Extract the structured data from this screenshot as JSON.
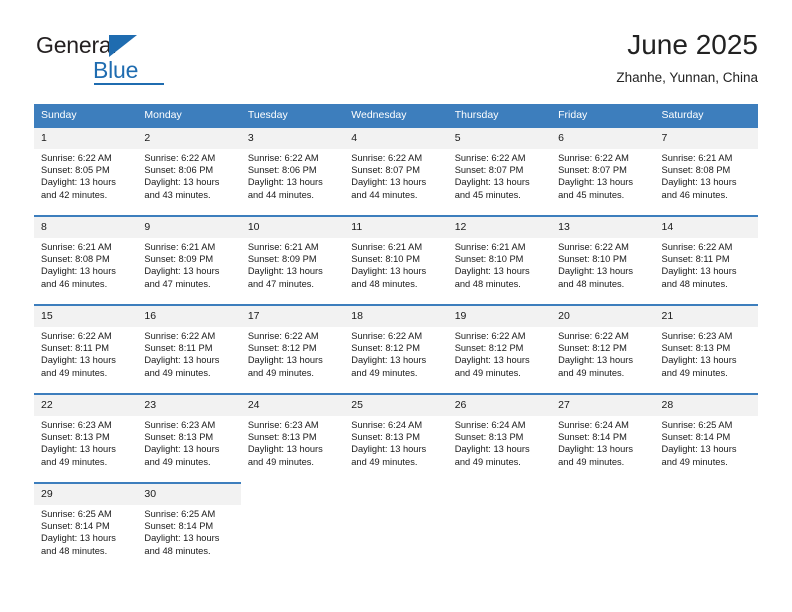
{
  "brand": {
    "name_part1": "General",
    "name_part2": "Blue",
    "color_primary": "#1f6cb0",
    "color_header": "#3d7ebd"
  },
  "header": {
    "title": "June 2025",
    "subtitle": "Zhanhe, Yunnan, China"
  },
  "calendar": {
    "weekday_headers": [
      "Sunday",
      "Monday",
      "Tuesday",
      "Wednesday",
      "Thursday",
      "Friday",
      "Saturday"
    ],
    "weeks": [
      [
        {
          "day": "1",
          "sunrise": "Sunrise: 6:22 AM",
          "sunset": "Sunset: 8:05 PM",
          "daylight": "Daylight: 13 hours and 42 minutes."
        },
        {
          "day": "2",
          "sunrise": "Sunrise: 6:22 AM",
          "sunset": "Sunset: 8:06 PM",
          "daylight": "Daylight: 13 hours and 43 minutes."
        },
        {
          "day": "3",
          "sunrise": "Sunrise: 6:22 AM",
          "sunset": "Sunset: 8:06 PM",
          "daylight": "Daylight: 13 hours and 44 minutes."
        },
        {
          "day": "4",
          "sunrise": "Sunrise: 6:22 AM",
          "sunset": "Sunset: 8:07 PM",
          "daylight": "Daylight: 13 hours and 44 minutes."
        },
        {
          "day": "5",
          "sunrise": "Sunrise: 6:22 AM",
          "sunset": "Sunset: 8:07 PM",
          "daylight": "Daylight: 13 hours and 45 minutes."
        },
        {
          "day": "6",
          "sunrise": "Sunrise: 6:22 AM",
          "sunset": "Sunset: 8:07 PM",
          "daylight": "Daylight: 13 hours and 45 minutes."
        },
        {
          "day": "7",
          "sunrise": "Sunrise: 6:21 AM",
          "sunset": "Sunset: 8:08 PM",
          "daylight": "Daylight: 13 hours and 46 minutes."
        }
      ],
      [
        {
          "day": "8",
          "sunrise": "Sunrise: 6:21 AM",
          "sunset": "Sunset: 8:08 PM",
          "daylight": "Daylight: 13 hours and 46 minutes."
        },
        {
          "day": "9",
          "sunrise": "Sunrise: 6:21 AM",
          "sunset": "Sunset: 8:09 PM",
          "daylight": "Daylight: 13 hours and 47 minutes."
        },
        {
          "day": "10",
          "sunrise": "Sunrise: 6:21 AM",
          "sunset": "Sunset: 8:09 PM",
          "daylight": "Daylight: 13 hours and 47 minutes."
        },
        {
          "day": "11",
          "sunrise": "Sunrise: 6:21 AM",
          "sunset": "Sunset: 8:10 PM",
          "daylight": "Daylight: 13 hours and 48 minutes."
        },
        {
          "day": "12",
          "sunrise": "Sunrise: 6:21 AM",
          "sunset": "Sunset: 8:10 PM",
          "daylight": "Daylight: 13 hours and 48 minutes."
        },
        {
          "day": "13",
          "sunrise": "Sunrise: 6:22 AM",
          "sunset": "Sunset: 8:10 PM",
          "daylight": "Daylight: 13 hours and 48 minutes."
        },
        {
          "day": "14",
          "sunrise": "Sunrise: 6:22 AM",
          "sunset": "Sunset: 8:11 PM",
          "daylight": "Daylight: 13 hours and 48 minutes."
        }
      ],
      [
        {
          "day": "15",
          "sunrise": "Sunrise: 6:22 AM",
          "sunset": "Sunset: 8:11 PM",
          "daylight": "Daylight: 13 hours and 49 minutes."
        },
        {
          "day": "16",
          "sunrise": "Sunrise: 6:22 AM",
          "sunset": "Sunset: 8:11 PM",
          "daylight": "Daylight: 13 hours and 49 minutes."
        },
        {
          "day": "17",
          "sunrise": "Sunrise: 6:22 AM",
          "sunset": "Sunset: 8:12 PM",
          "daylight": "Daylight: 13 hours and 49 minutes."
        },
        {
          "day": "18",
          "sunrise": "Sunrise: 6:22 AM",
          "sunset": "Sunset: 8:12 PM",
          "daylight": "Daylight: 13 hours and 49 minutes."
        },
        {
          "day": "19",
          "sunrise": "Sunrise: 6:22 AM",
          "sunset": "Sunset: 8:12 PM",
          "daylight": "Daylight: 13 hours and 49 minutes."
        },
        {
          "day": "20",
          "sunrise": "Sunrise: 6:22 AM",
          "sunset": "Sunset: 8:12 PM",
          "daylight": "Daylight: 13 hours and 49 minutes."
        },
        {
          "day": "21",
          "sunrise": "Sunrise: 6:23 AM",
          "sunset": "Sunset: 8:13 PM",
          "daylight": "Daylight: 13 hours and 49 minutes."
        }
      ],
      [
        {
          "day": "22",
          "sunrise": "Sunrise: 6:23 AM",
          "sunset": "Sunset: 8:13 PM",
          "daylight": "Daylight: 13 hours and 49 minutes."
        },
        {
          "day": "23",
          "sunrise": "Sunrise: 6:23 AM",
          "sunset": "Sunset: 8:13 PM",
          "daylight": "Daylight: 13 hours and 49 minutes."
        },
        {
          "day": "24",
          "sunrise": "Sunrise: 6:23 AM",
          "sunset": "Sunset: 8:13 PM",
          "daylight": "Daylight: 13 hours and 49 minutes."
        },
        {
          "day": "25",
          "sunrise": "Sunrise: 6:24 AM",
          "sunset": "Sunset: 8:13 PM",
          "daylight": "Daylight: 13 hours and 49 minutes."
        },
        {
          "day": "26",
          "sunrise": "Sunrise: 6:24 AM",
          "sunset": "Sunset: 8:13 PM",
          "daylight": "Daylight: 13 hours and 49 minutes."
        },
        {
          "day": "27",
          "sunrise": "Sunrise: 6:24 AM",
          "sunset": "Sunset: 8:14 PM",
          "daylight": "Daylight: 13 hours and 49 minutes."
        },
        {
          "day": "28",
          "sunrise": "Sunrise: 6:25 AM",
          "sunset": "Sunset: 8:14 PM",
          "daylight": "Daylight: 13 hours and 49 minutes."
        }
      ],
      [
        {
          "day": "29",
          "sunrise": "Sunrise: 6:25 AM",
          "sunset": "Sunset: 8:14 PM",
          "daylight": "Daylight: 13 hours and 48 minutes."
        },
        {
          "day": "30",
          "sunrise": "Sunrise: 6:25 AM",
          "sunset": "Sunset: 8:14 PM",
          "daylight": "Daylight: 13 hours and 48 minutes."
        },
        null,
        null,
        null,
        null,
        null
      ]
    ]
  }
}
